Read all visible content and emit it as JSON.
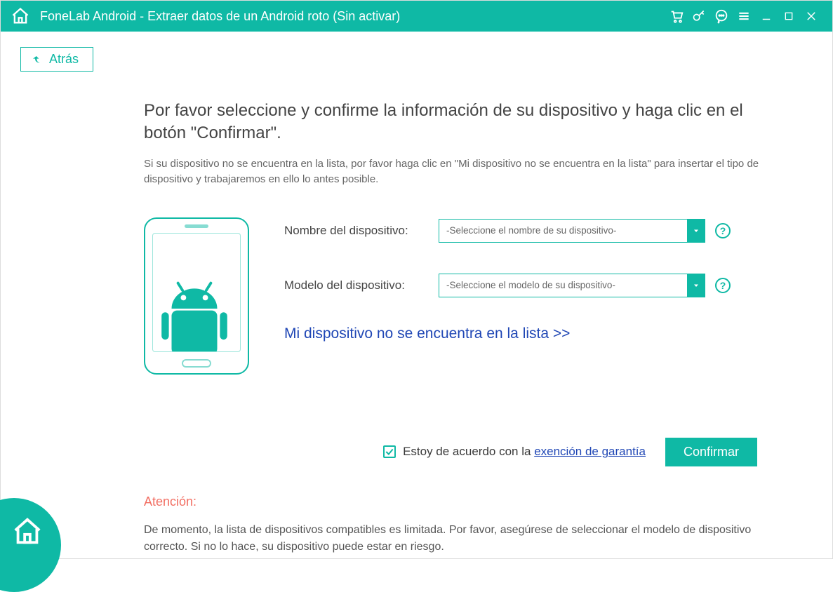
{
  "titlebar": {
    "title": "FoneLab Android - Extraer datos de un Android roto (Sin activar)"
  },
  "back": {
    "label": "Atrás"
  },
  "heading": "Por favor seleccione y confirme la información de su dispositivo y haga clic en el botón \"Confirmar\".",
  "sub": "Si su dispositivo no se encuentra en la lista, por favor haga clic en \"Mi dispositivo no se encuentra en la lista\" para insertar el tipo de dispositivo y trabajaremos en ello lo antes posible.",
  "fields": {
    "device_name": {
      "label": "Nombre del dispositivo:",
      "placeholder": "-Seleccione el nombre de su dispositivo-"
    },
    "device_model": {
      "label": "Modelo del dispositivo:",
      "placeholder": "-Seleccione el modelo de su dispositivo-"
    }
  },
  "not_in_list": "Mi dispositivo no se encuentra en la lista >>",
  "agree": {
    "prefix": "Estoy de acuerdo con la ",
    "link": "exención de garantía",
    "checked": true
  },
  "confirm": "Confirmar",
  "attention": {
    "label": "Atención:",
    "text": "De momento, la lista de dispositivos compatibles es limitada. Por favor, asegúrese de seleccionar el modelo de dispositivo correcto. Si no lo hace, su dispositivo puede estar en riesgo."
  },
  "help_glyph": "?"
}
